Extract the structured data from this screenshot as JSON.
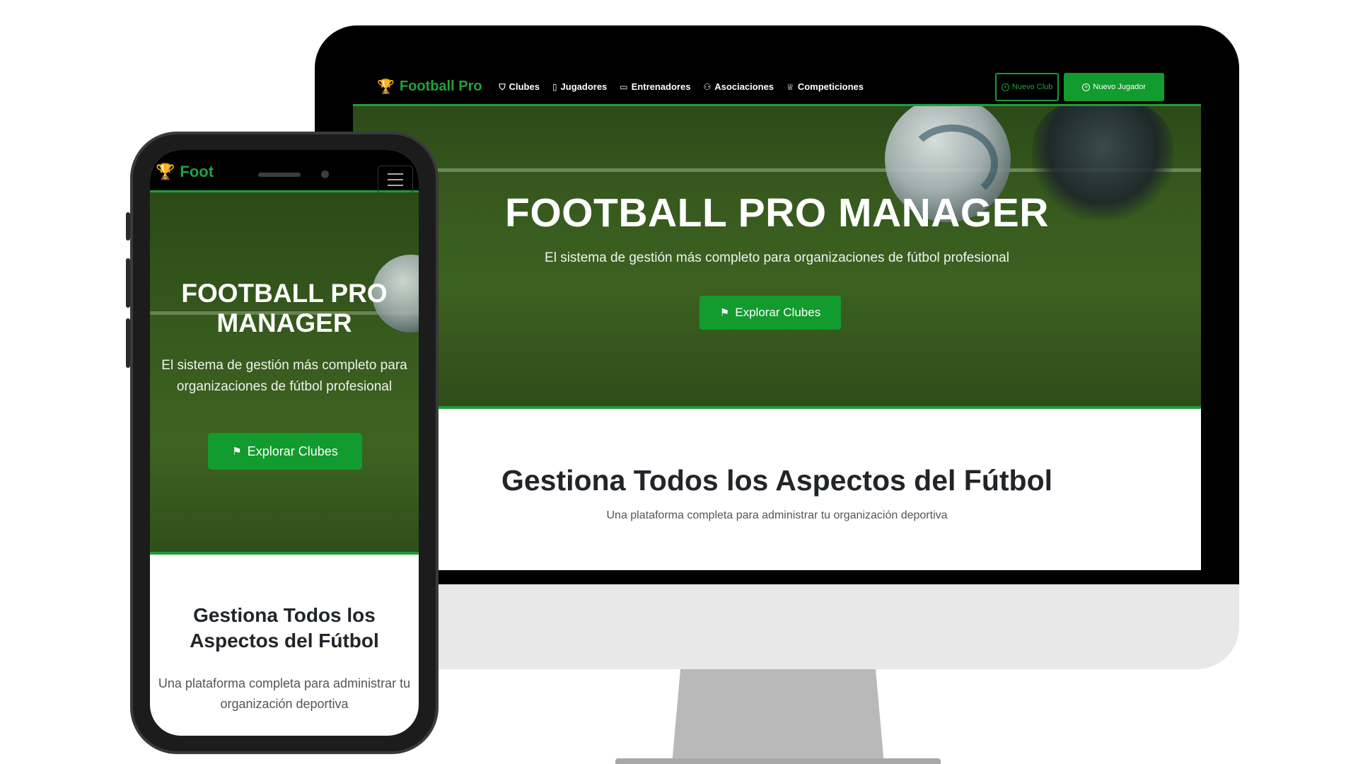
{
  "desktop": {
    "nav": {
      "brand": "Football Pro",
      "links": [
        {
          "label": "Clubes",
          "icon": "shield-icon"
        },
        {
          "label": "Jugadores",
          "icon": "id-card-icon"
        },
        {
          "label": "Entrenadores",
          "icon": "whiteboard-icon"
        },
        {
          "label": "Asociaciones",
          "icon": "people-icon"
        },
        {
          "label": "Competiciones",
          "icon": "trophy-icon"
        }
      ],
      "new_club": "Nuevo Club",
      "new_player": "Nuevo Jugador"
    },
    "hero": {
      "title": "FOOTBALL PRO MANAGER",
      "subtitle": "El sistema de gestión más completo para organizaciones de fútbol profesional",
      "cta": "Explorar Clubes"
    },
    "section": {
      "title": "Gestiona Todos los Aspectos del Fútbol",
      "subtitle": "Una plataforma completa para administrar tu organización deportiva"
    }
  },
  "mobile": {
    "nav": {
      "brand": "Foot"
    },
    "hero": {
      "title": "FOOTBALL PRO MANAGER",
      "subtitle": "El sistema de gestión más completo para organizaciones de fútbol profesional",
      "cta": "Explorar Clubes"
    },
    "section": {
      "title": "Gestiona Todos los Aspectos del Fútbol",
      "subtitle": "Una plataforma completa para administrar tu organización deportiva"
    }
  },
  "colors": {
    "brand_green": "#1fa33d",
    "button_green": "#129b2e",
    "nav_bg": "#000000"
  }
}
